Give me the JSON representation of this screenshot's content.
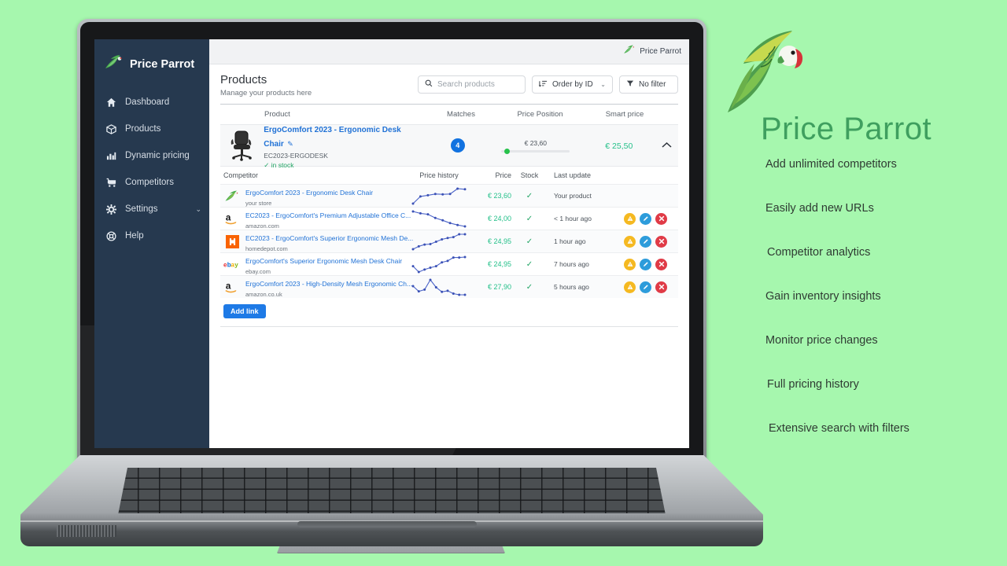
{
  "theme": {
    "page_bg": "#a6f7ae",
    "sidebar_bg": "#26394f",
    "brand_green": "#3f9f5f",
    "link_blue": "#2172d6",
    "price_green": "#25c08a",
    "badge_blue": "#1172e0",
    "warn_yellow": "#f5b921",
    "edit_blue": "#2d9cdb",
    "delete_red": "#e03b47"
  },
  "promo": {
    "logo_icon": "parrot-logo-icon",
    "title": "Price Parrot",
    "items": [
      "Add unlimited competitors",
      "Easily add new URLs",
      "Competitor analytics",
      "Gain inventory insights",
      "Monitor price changes",
      "Full pricing history",
      "Extensive search with filters"
    ]
  },
  "app": {
    "sidebar": {
      "brand": "Price Parrot",
      "brand_icon": "parrot-logo-icon",
      "items": [
        {
          "label": "Dashboard",
          "icon": "home-icon",
          "chevron": ""
        },
        {
          "label": "Products",
          "icon": "box-icon",
          "chevron": ""
        },
        {
          "label": "Dynamic pricing",
          "icon": "bar-chart-icon",
          "chevron": ""
        },
        {
          "label": "Competitors",
          "icon": "shopping-cart-icon",
          "chevron": ""
        },
        {
          "label": "Settings",
          "icon": "gear-icon",
          "chevron": "⌄"
        },
        {
          "label": "Help",
          "icon": "life-ring-icon",
          "chevron": ""
        }
      ]
    },
    "topbar": {
      "account_name": "Price Parrot",
      "account_icon": "parrot-logo-icon"
    },
    "page": {
      "title": "Products",
      "subtitle": "Manage your products here"
    },
    "tools": {
      "search_icon": "search-icon",
      "search_value": "",
      "search_placeholder": "Search products",
      "order_icon": "sort-amount-icon",
      "order_label": "Order by ID",
      "order_chevron": "⌄",
      "filter_icon": "funnel-icon",
      "filter_label": "No filter"
    },
    "product_table": {
      "headers": {
        "product": "Product",
        "matches": "Matches",
        "price_position": "Price Position",
        "smart_price": "Smart price"
      },
      "row": {
        "thumb_icon": "office-chair-icon",
        "name": "ErgoComfort 2023 - Ergonomic Desk Chair",
        "edit_icon": "pencil-icon",
        "sku": "EC2023-ERGODESK",
        "stock_icon": "check-icon",
        "stock_label": "in stock",
        "matches": "4",
        "price_position_value": "€ 23,60",
        "price_position_percent": 4,
        "smart_price": "€ 25,50",
        "collapse_icon": "chevron-up-icon"
      }
    },
    "competitor_table": {
      "headers": {
        "competitor": "Competitor",
        "price_history": "Price history",
        "price": "Price",
        "stock": "Stock",
        "last_update": "Last update"
      },
      "rows": [
        {
          "logo": "parrot-logo-icon",
          "title": "ErgoComfort 2023 - Ergonomic Desk Chair",
          "domain": "your store",
          "sparkline": [
            22,
            46,
            50,
            54,
            53,
            54,
            72,
            70
          ],
          "price": "€ 23,60",
          "stock_icon": "check-icon",
          "last_update": "Your product",
          "actions": []
        },
        {
          "logo": "amazon-icon",
          "title": "EC2023 - ErgoComfort's Premium Adjustable Office C...",
          "domain": "amazon.com",
          "sparkline": [
            78,
            70,
            66,
            50,
            40,
            28,
            20,
            14
          ],
          "price": "€ 24,00",
          "stock_icon": "check-icon",
          "last_update": "< 1 hour ago",
          "actions": [
            "warning-icon",
            "pencil-icon",
            "close-icon"
          ]
        },
        {
          "logo": "homedepot-icon",
          "title": "EC2023 - ErgoComfort's Superior Ergonomic Mesh De...",
          "domain": "homedepot.com",
          "sparkline": [
            14,
            26,
            34,
            36,
            46,
            56,
            62,
            66,
            78,
            78
          ],
          "price": "€ 24,95",
          "stock_icon": "check-icon",
          "last_update": "1 hour ago",
          "actions": [
            "warning-icon",
            "pencil-icon",
            "close-icon"
          ]
        },
        {
          "logo": "ebay-icon",
          "title": "ErgoComfort's Superior Ergonomic Mesh Desk Chair",
          "domain": "ebay.com",
          "sparkline": [
            40,
            16,
            26,
            34,
            40,
            56,
            62,
            76,
            76,
            78
          ],
          "price": "€ 24,95",
          "stock_icon": "check-icon",
          "last_update": "7 hours ago",
          "actions": [
            "warning-icon",
            "pencil-icon",
            "close-icon"
          ]
        },
        {
          "logo": "amazon-icon",
          "title": "ErgoComfort 2023 - High-Density Mesh Ergonomic Ch...",
          "domain": "amazon.co.uk",
          "sparkline": [
            48,
            30,
            36,
            70,
            44,
            28,
            32,
            22,
            18,
            18
          ],
          "price": "€ 27,90",
          "stock_icon": "check-icon",
          "last_update": "5 hours ago",
          "actions": [
            "warning-icon",
            "pencil-icon",
            "close-icon"
          ]
        }
      ],
      "add_link_label": "Add link"
    }
  }
}
